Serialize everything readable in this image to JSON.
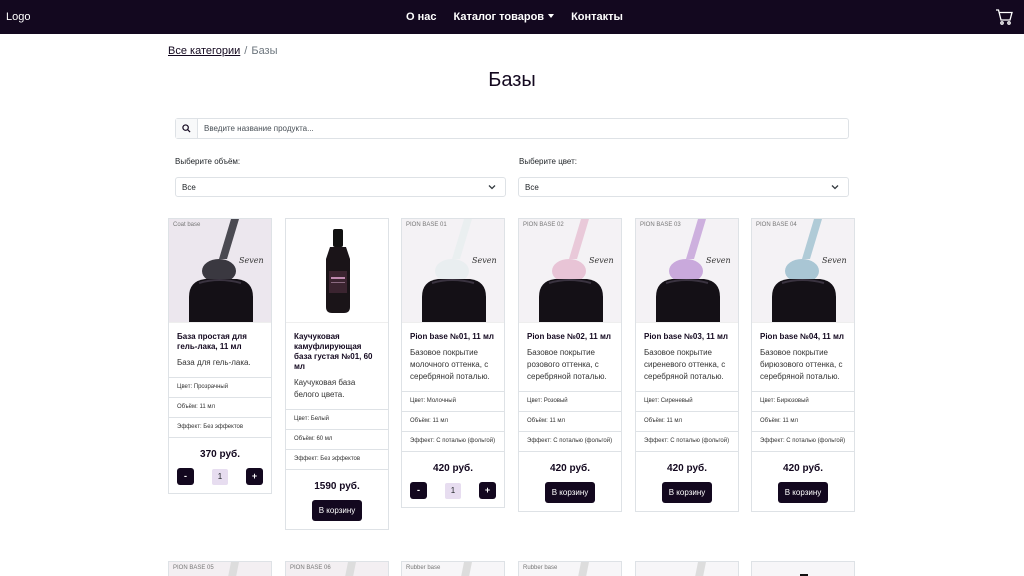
{
  "nav": {
    "logo": "Logo",
    "links": [
      "О нас",
      "Каталог товаров",
      "Контакты"
    ]
  },
  "breadcrumb": {
    "root": "Все категории",
    "sep": "/",
    "current": "Базы"
  },
  "page_title": "Базы",
  "search": {
    "placeholder": "Введите название продукта...",
    "value": ""
  },
  "filters": {
    "volume_label": "Выберите объём:",
    "volume_value": "Все",
    "color_label": "Выберите цвет:",
    "color_value": "Все"
  },
  "products": [
    {
      "tag": "Coat base",
      "title": "База простая для гель-лака, 11 мл",
      "desc": "База для гель-лака.",
      "props": [
        "Цвет: Прозрачный",
        "Объём: 11 мл",
        "Эффект: Без эффектов"
      ],
      "price": "370 руб.",
      "qty": "1",
      "minus": "-",
      "plus": "+"
    },
    {
      "tag": "",
      "title": "Каучуковая камуфлирующая база густая №01, 60 мл",
      "desc": "Каучуковая база белого цвета.",
      "props": [
        "Цвет: Белый",
        "Объём: 60 мл",
        "Эффект: Без эффектов"
      ],
      "price": "1590 руб.",
      "button": "В корзину"
    },
    {
      "tag": "PION BASE 01",
      "title": "Pion base №01, 11 мл",
      "desc": "Базовое покрытие молочного оттенка, с серебряной поталью.",
      "props": [
        "Цвет: Молочный",
        "Объём: 11 мл",
        "Эффект: С поталью (фольгой)"
      ],
      "price": "420 руб.",
      "qty": "1",
      "minus": "-",
      "plus": "+"
    },
    {
      "tag": "PION BASE 02",
      "title": "Pion base №02, 11 мл",
      "desc": "Базовое покрытие розового оттенка, с серебряной поталью.",
      "props": [
        "Цвет: Розовый",
        "Объём: 11 мл",
        "Эффект: С поталью (фольгой)"
      ],
      "price": "420 руб.",
      "button": "В корзину"
    },
    {
      "tag": "PION BASE 03",
      "title": "Pion base №03, 11 мл",
      "desc": "Базовое покрытие сиреневого оттенка, с серебряной поталью.",
      "props": [
        "Цвет: Сиреневый",
        "Объём: 11 мл",
        "Эффект: С поталью (фольгой)"
      ],
      "price": "420 руб.",
      "button": "В корзину"
    },
    {
      "tag": "PION BASE 04",
      "title": "Pion base №04, 11 мл",
      "desc": "Базовое покрытие бирюзового оттенка, с серебряной поталью.",
      "props": [
        "Цвет: Бирюзовый",
        "Объём: 11 мл",
        "Эффект: С поталью (фольгой)"
      ],
      "price": "420 руб.",
      "button": "В корзину"
    }
  ],
  "next_row_tags": [
    "PION BASE 05",
    "PION BASE 06",
    "Rubber base",
    "Rubber base",
    "",
    ""
  ],
  "colors": {
    "brand_dark": "#13081f",
    "qty_bg": "#e7ddf0",
    "polish_colors": [
      "#3a3840",
      "#2a1a24",
      "#e9eef0",
      "#e8c4d6",
      "#c9a9dc",
      "#a9c6d4"
    ]
  }
}
